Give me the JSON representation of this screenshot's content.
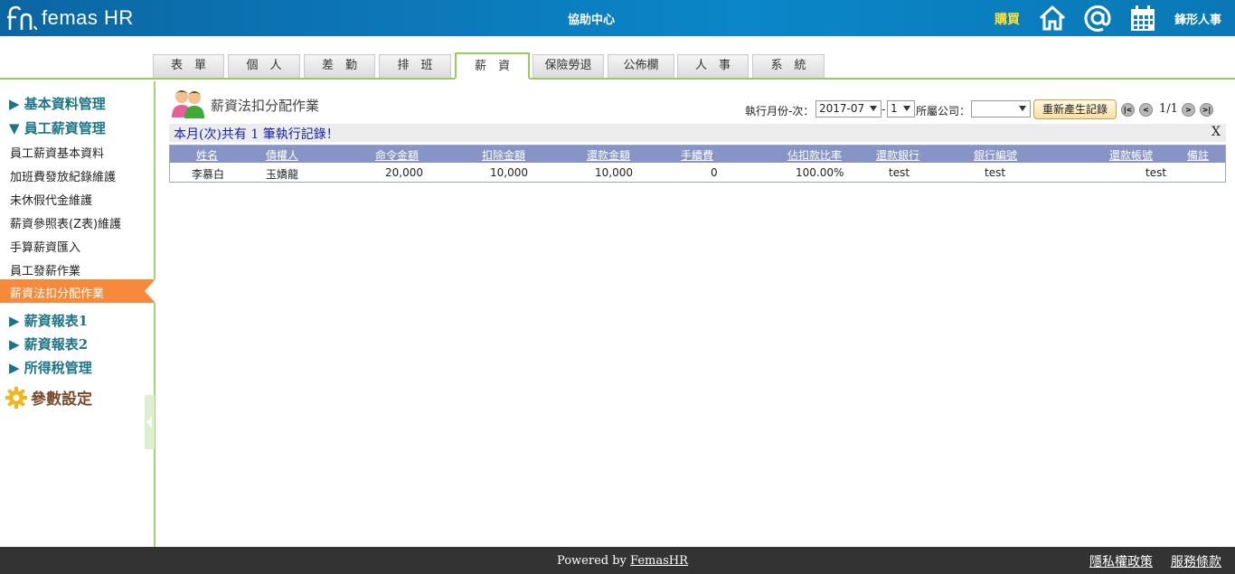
{
  "header": {
    "logo_text": "femas HR",
    "help_center": "協助中心",
    "purchase": "購買",
    "company": "鋒形人事",
    "icons": [
      "home-icon",
      "at-icon",
      "calendar-icon"
    ]
  },
  "tabs": [
    {
      "label": "表　單"
    },
    {
      "label": "個　人"
    },
    {
      "label": "差　勤"
    },
    {
      "label": "排　班"
    },
    {
      "label": "薪　資",
      "active": true
    },
    {
      "label": "保險勞退"
    },
    {
      "label": "公佈欄"
    },
    {
      "label": "人　事"
    },
    {
      "label": "系　統"
    }
  ],
  "sidebar": {
    "groups": {
      "basic": "▶ 基本資料管理",
      "salary_mgmt": "▼ 員工薪資管理",
      "report1": "▶ 薪資報表1",
      "report2": "▶ 薪資報表2",
      "tax": "▶ 所得稅管理"
    },
    "items": [
      "員工薪資基本資料",
      "加班費發放紀錄維護",
      "未休假代金維護",
      "薪資參照表(Z表)維護",
      "手算薪資匯入",
      "員工發薪作業",
      "薪資法扣分配作業"
    ],
    "param_settings": "參數設定"
  },
  "main": {
    "title": "薪資法扣分配作業",
    "month_label": "執行月份-次：",
    "month_value": "2017-07",
    "dash": "-",
    "run_value": "1",
    "company_label": "所屬公司：",
    "company_value": "",
    "regen_button": "重新產生記錄",
    "pager": {
      "first": "|<",
      "prev": "<",
      "info": "1/1",
      "next": ">",
      "last": ">|"
    },
    "notice": "本月(次)共有 1 筆執行記錄！",
    "notice_close": "X",
    "table": {
      "columns": [
        "姓名",
        "債權人",
        "命令金額",
        "扣除金額",
        "還款金額",
        "手續費",
        "佔扣款比率",
        "還款銀行",
        "銀行編號",
        "還款帳號",
        "備註"
      ],
      "rows": [
        [
          "李慕白",
          "玉嬌龍",
          "20,000",
          "10,000",
          "10,000",
          "0",
          "100.00%",
          "test",
          "test",
          "test",
          ""
        ]
      ]
    }
  },
  "footer": {
    "powered_prefix": "Powered by ",
    "powered_link": "FemasHR",
    "privacy": "隱私權政策",
    "terms": "服務條款"
  }
}
